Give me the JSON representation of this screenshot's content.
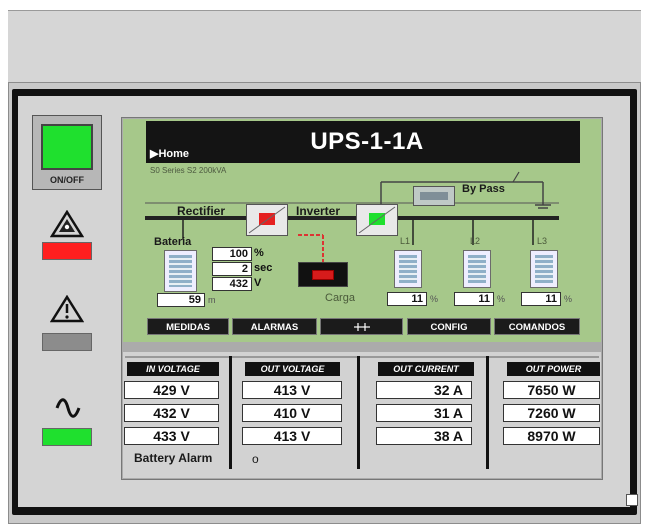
{
  "device": {
    "title": "UPS-1-1A",
    "home_label": "Home",
    "series_label": "S0 Series S2 200kVA"
  },
  "colors": {
    "screen_bg": "#a6c88a",
    "on_green": "#1fe02e",
    "alarm_red": "#ff1f1f",
    "warning_gray": "#8c8c8c",
    "ac_green": "#1fe02e"
  },
  "left_panel": {
    "onoff_label": "ON/OFF",
    "indicators": [
      {
        "icon": "warning-triangle-icon",
        "status_color": "#ff1f1f"
      },
      {
        "icon": "warning-triangle-icon",
        "status_color": "#8c8c8c"
      },
      {
        "icon": "ac-sine-wave-icon",
        "status_color": "#1fe02e"
      }
    ]
  },
  "diagram": {
    "bypass_label": "By Pass",
    "rectifier_label": "Rectifier",
    "inverter_label": "Inverter",
    "battery_label": "Bateria",
    "battery_percent": "100",
    "battery_percent_unit": "%",
    "battery_seconds": "2",
    "battery_seconds_unit": "sec",
    "battery_voltage": "432",
    "battery_voltage_unit": "V",
    "battery_minutes": "59",
    "battery_minutes_unit": "m",
    "load_label": "Carga",
    "phases": [
      {
        "label": "L1",
        "load": "11",
        "unit": "%"
      },
      {
        "label": "L2",
        "load": "11",
        "unit": "%"
      },
      {
        "label": "L3",
        "load": "11",
        "unit": "%"
      }
    ]
  },
  "menu": [
    "MEDIDAS",
    "ALARMAS",
    "",
    "CONFIG",
    "COMANDOS"
  ],
  "measurements": {
    "columns": [
      {
        "header": "IN VOLTAGE",
        "values": [
          "429 V",
          "432 V",
          "433 V"
        ]
      },
      {
        "header": "OUT VOLTAGE",
        "values": [
          "413 V",
          "410 V",
          "413 V"
        ]
      },
      {
        "header": "OUT CURRENT",
        "values": [
          "32 A",
          "31 A",
          "38 A"
        ]
      },
      {
        "header": "OUT POWER",
        "values": [
          "7650 W",
          "7260 W",
          "8970 W"
        ]
      }
    ],
    "battery_alarm_label": "Battery Alarm",
    "battery_alarm_indicator": "o"
  }
}
